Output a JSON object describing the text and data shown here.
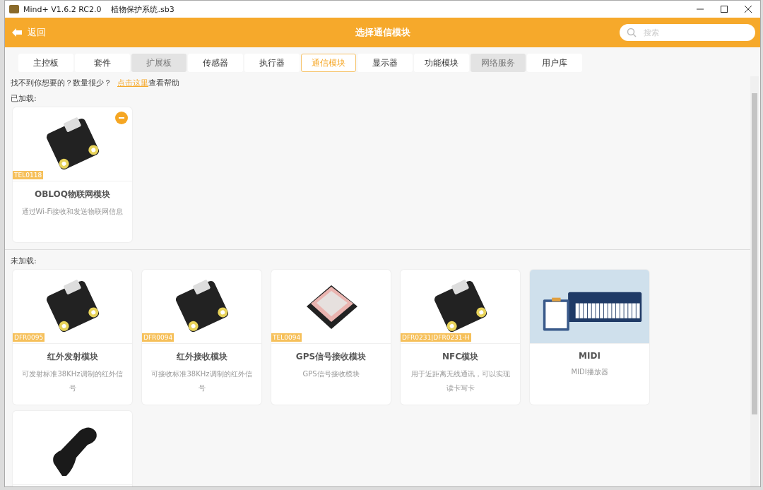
{
  "window": {
    "title": "Mind+ V1.6.2 RC2.0    植物保护系统.sb3"
  },
  "header": {
    "back": "返回",
    "title": "选择通信模块",
    "search": {
      "placeholder": "搜索"
    }
  },
  "tabs": [
    {
      "label": "主控板",
      "selected": false,
      "disabled": false
    },
    {
      "label": "套件",
      "selected": false,
      "disabled": false
    },
    {
      "label": "扩展板",
      "selected": false,
      "disabled": true
    },
    {
      "label": "传感器",
      "selected": false,
      "disabled": false
    },
    {
      "label": "执行器",
      "selected": false,
      "disabled": false
    },
    {
      "label": "通信模块",
      "selected": true,
      "disabled": false
    },
    {
      "label": "显示器",
      "selected": false,
      "disabled": false
    },
    {
      "label": "功能模块",
      "selected": false,
      "disabled": false
    },
    {
      "label": "网络服务",
      "selected": false,
      "disabled": true
    },
    {
      "label": "用户库",
      "selected": false,
      "disabled": false
    }
  ],
  "help": {
    "text": "找不到你想要的？数量很少？",
    "link": "点击这里",
    "after": "查看帮助"
  },
  "sections": [
    {
      "label": "已加载:",
      "cards": [
        {
          "kind": "board",
          "code": "TEL0118",
          "title": "OBLOQ物联网模块",
          "description": "通过Wi-Fi接收和发送物联网信息",
          "loaded": true
        }
      ]
    },
    {
      "label": "未加载:",
      "cards": [
        {
          "kind": "board",
          "code": "DFR0095",
          "title": "红外发射模块",
          "description": "可发射标准38KHz调制的红外信号",
          "loaded": false
        },
        {
          "kind": "board",
          "code": "DFR0094",
          "title": "红外接收模块",
          "description": "可接收标准38KHz调制的红外信号",
          "loaded": false
        },
        {
          "kind": "gps",
          "code": "TEL0094",
          "title": "GPS信号接收模块",
          "description": "GPS信号接收模块",
          "loaded": false
        },
        {
          "kind": "board",
          "code": "DFR0231|DFR0231-H",
          "title": "NFC模块",
          "description": "用于近距离无线通讯，可以实现读卡写卡",
          "loaded": false
        },
        {
          "kind": "keyboard",
          "title": "MIDI",
          "description": "MIDI播放器",
          "loaded": false
        },
        {
          "kind": "gamepad",
          "loaded": false
        }
      ]
    }
  ]
}
